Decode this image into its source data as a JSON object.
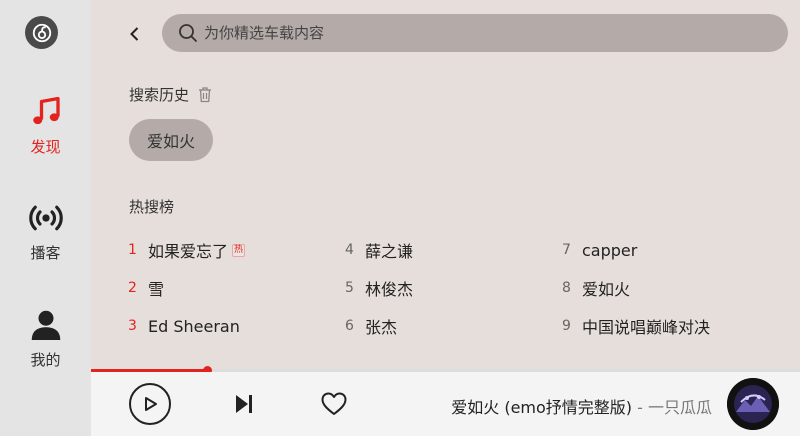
{
  "sidebar": {
    "items": [
      {
        "label": "发现",
        "icon": "music-note-icon",
        "active": true
      },
      {
        "label": "播客",
        "icon": "broadcast-icon",
        "active": false
      },
      {
        "label": "我的",
        "icon": "user-icon",
        "active": false
      }
    ]
  },
  "search": {
    "placeholder": "为你精选车载内容",
    "value": ""
  },
  "history": {
    "title": "搜索历史",
    "items": [
      "爱如火"
    ]
  },
  "hot": {
    "title": "热搜榜",
    "badge": "热",
    "items": [
      {
        "rank": "1",
        "text": "如果爱忘了"
      },
      {
        "rank": "2",
        "text": "雪"
      },
      {
        "rank": "3",
        "text": "Ed Sheeran"
      },
      {
        "rank": "4",
        "text": "薛之谦"
      },
      {
        "rank": "5",
        "text": "林俊杰"
      },
      {
        "rank": "6",
        "text": "张杰"
      },
      {
        "rank": "7",
        "text": "capper"
      },
      {
        "rank": "8",
        "text": "爱如火"
      },
      {
        "rank": "9",
        "text": "中国说唱巅峰对决"
      }
    ]
  },
  "player": {
    "track": "爱如火 (emo抒情完整版)",
    "separator": " - ",
    "artist": "一只瓜瓜",
    "progress": 0.163
  },
  "colors": {
    "accent": "#e2231f",
    "chip": "#b4aba8",
    "background": "#e6deda"
  }
}
